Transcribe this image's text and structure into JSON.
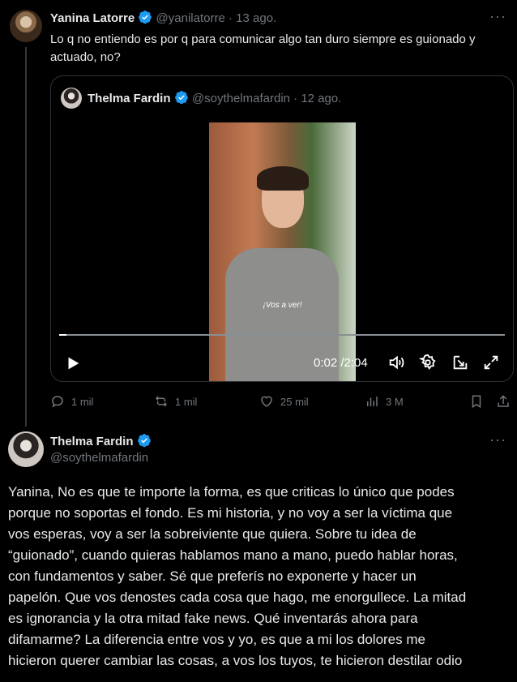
{
  "tweet1": {
    "author_name": "Yanina Latorre",
    "handle": "@yanilatorre",
    "separator": "·",
    "date": "13 ago.",
    "text": "Lo q no entiendo es por q para comunicar algo tan duro siempre es guionado y actuado, no?",
    "more_label": "···"
  },
  "quoted": {
    "author_name": "Thelma Fardin",
    "handle": "@soythelmafardin",
    "separator": "·",
    "date": "12 ago.",
    "video": {
      "caption": "¡Vos a ver!",
      "current_time": "0:02",
      "time_sep": "/",
      "duration": "2:04",
      "progress": 0.016
    }
  },
  "actions": {
    "replies": "1 mil",
    "reposts": "1 mil",
    "likes": "25 mil",
    "views": "3 M"
  },
  "tweet2": {
    "author_name": "Thelma Fardin",
    "handle": "@soythelmafardin",
    "more_label": "···",
    "lines": [
      "Yanina, No es que te importe la forma, es que criticas lo único que podes",
      "porque no soportas el fondo. Es mi historia, y no voy a ser la víctima que",
      "vos esperas, voy a ser la sobreiviente que quiera. Sobre tu idea de",
      "“guionado”, cuando quieras hablamos mano a mano, puedo hablar horas,",
      "con fundamentos y saber. Sé que preferís no exponerte y hacer un",
      "papelón. Que vos denostes cada cosa que hago, me enorgullece. La mitad",
      "es ignorancia y la otra mitad fake news. Qué inventarás ahora para",
      "difamarme? La diferencia entre vos y yo, es que a mi los dolores me",
      "hicieron querer cambiar las cosas, a vos los tuyos, te hicieron destilar odio"
    ]
  },
  "colors": {
    "background": "#000000",
    "text": "#e7e9ea",
    "muted": "#71767b",
    "verified": "#1d9bf0",
    "border": "#2f3336"
  }
}
